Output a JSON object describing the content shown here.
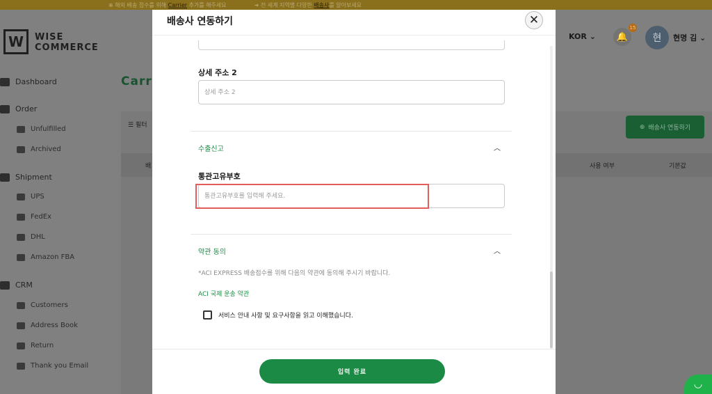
{
  "banner": {
    "left_text_pre": "해외 배송 접수를 위해",
    "left_link": "Carrier",
    "left_text_post": "추가를 해주세요",
    "right_text_pre": "전 세계 지역별 다양한",
    "right_link": "배송사",
    "right_text_post": "를 알아보세요"
  },
  "brand": {
    "line1": "WISE",
    "line2": "COMMERCE",
    "mark": "W"
  },
  "header": {
    "language": "KOR",
    "notification_count": "15",
    "avatar_initial": "현",
    "user_name": "현명 김"
  },
  "sidebar": {
    "dashboard": "Dashboard",
    "order": "Order",
    "unfulfilled": "Unfulfilled",
    "archived": "Archived",
    "shipment": "Shipment",
    "ups": "UPS",
    "fedex": "FedEx",
    "dhl": "DHL",
    "amazon_fba": "Amazon FBA",
    "crm": "CRM",
    "customers": "Customers",
    "address_book": "Address Book",
    "return": "Return",
    "thank_you_email": "Thank you Email"
  },
  "page": {
    "title": "Carri",
    "filter_label": "필터",
    "connect_button": "배송사 연동하기",
    "col_first": "배",
    "col_use": "사용 여부",
    "col_default": "기본값"
  },
  "modal": {
    "title": "배송사 연동하기",
    "detail_address2_label": "상세 주소 2",
    "detail_address2_placeholder": "상세 주소 2",
    "export_section": "수출신고",
    "customs_id_label": "통관고유부호",
    "customs_id_placeholder": "통관고유부호를 입력해 주세요.",
    "terms_section": "약관 동의",
    "terms_note": "*ACI EXPRESS 배송접수를 위해 다음의 약관에 동의해 주시기 바랍니다.",
    "terms_link": "ACI 국제 운송 약관",
    "agree_label": "서비스 안내 사항 및 요구사항을 읽고 이해했습니다.",
    "submit_button": "입력 완료"
  },
  "colors": {
    "accent_green": "#1a8a45",
    "highlight_red": "#e25c5c"
  }
}
